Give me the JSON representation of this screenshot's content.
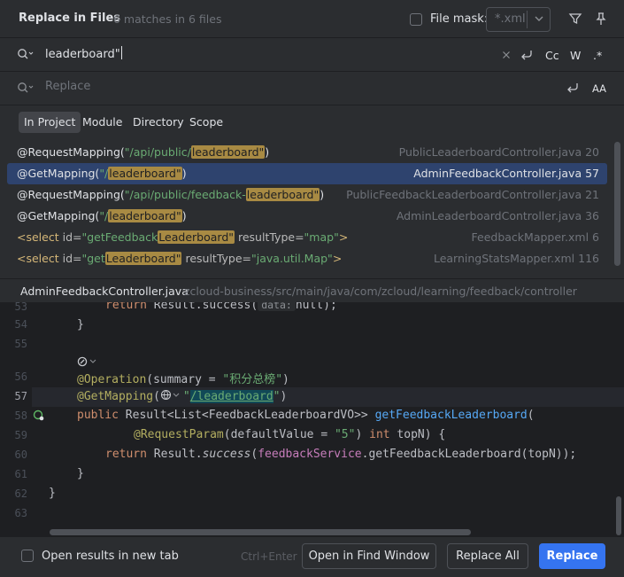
{
  "header": {
    "title": "Replace in Files",
    "match_count": "6 matches in 6 files",
    "file_mask_label": "File mask:",
    "file_mask_placeholder": "*.xml"
  },
  "search": {
    "value": "leaderboard\"",
    "toggles": [
      "Cc",
      "W",
      ".*"
    ]
  },
  "replace": {
    "placeholder": "Replace",
    "case_toggle": "AA"
  },
  "scope_tabs": [
    {
      "label": "In Project",
      "active": true
    },
    {
      "label": "Module"
    },
    {
      "label": "Directory"
    },
    {
      "label": "Scope"
    }
  ],
  "results": [
    {
      "pre": "@RequestMapping(",
      "str_pre": "\"/api/public/",
      "match": "leaderboard\"",
      "post": ")",
      "file": "PublicLeaderboardController.java",
      "line": "20"
    },
    {
      "pre": "@GetMapping(",
      "str_pre": "\"/",
      "match": "leaderboard\"",
      "post": ")",
      "file": "AdminFeedbackController.java",
      "line": "57",
      "selected": true
    },
    {
      "pre": "@RequestMapping(",
      "str_pre": "\"/api/public/feedback-",
      "match": "leaderboard\"",
      "post": ")",
      "file": "PublicFeedbackLeaderboardController.java",
      "line": "21"
    },
    {
      "pre": "@GetMapping(",
      "str_pre": "\"/",
      "match": "leaderboard\"",
      "post": ")",
      "file": "AdminLeaderboardController.java",
      "line": "36"
    },
    {
      "tag": "<select",
      "attr": " id=",
      "str_pre": "\"getFeedback",
      "match": "Leaderboard\"",
      "attr2": " resultType=",
      "str2": "\"map\"",
      "tail": ">",
      "file": "FeedbackMapper.xml",
      "line": "6"
    },
    {
      "tag": "<select",
      "attr": " id=",
      "str_pre": "\"get",
      "match": "Leaderboard\"",
      "attr2": " resultType=",
      "str2": "\"java.util.Map\"",
      "tail": ">",
      "file": "LearningStatsMapper.xml",
      "line": "116"
    }
  ],
  "preview": {
    "file_name": "AdminFeedbackController.java",
    "path": "zcloud-business/src/main/java/com/zcloud/learning/feedback/controller"
  },
  "editor": {
    "line_numbers": [
      "53",
      "54",
      "55",
      "",
      "56",
      "57",
      "58",
      "59",
      "60",
      "61",
      "62",
      "63"
    ],
    "current_line": "57",
    "lines": {
      "l53_kw": "return",
      "l53_a": " Result.success(",
      "l53_hint": "data:",
      "l53_b": "null);",
      "l54": "}",
      "l56_ann": "@Operation",
      "l56_a": "(summary = ",
      "l56_str": "\"积分总榜\"",
      "l56_b": ")",
      "l57_ann": "@GetMapping",
      "l57_a": "(",
      "l57_str_a": "\"",
      "l57_match": "/leaderboard",
      "l57_str_b": "\"",
      "l57_b": ")",
      "l58_kw": "public",
      "l58_a": " Result<List<FeedbackLeaderboardVO>> ",
      "l58_fn": "getFeedbackLeaderboard",
      "l58_b": "(",
      "l59_ann": "@RequestParam",
      "l59_a": "(defaultValue = ",
      "l59_str": "\"5\"",
      "l59_b": ") ",
      "l59_kw": "int",
      "l59_c": " topN) {",
      "l60_kw": "return",
      "l60_a": " Result.",
      "l60_it": "success",
      "l60_b": "(",
      "l60_fld": "feedbackService",
      "l60_c": ".getFeedbackLeaderboard(topN));",
      "l61": "}",
      "l62": "}"
    }
  },
  "footer": {
    "open_new_tab_label": "Open results in new tab",
    "shortcut": "Ctrl+Enter",
    "open_find_window": "Open in Find Window",
    "replace_all": "Replace All",
    "replace": "Replace"
  },
  "colors": {
    "accent": "#3574f0",
    "selection": "#2e436e",
    "match_highlight": "#a88a43"
  }
}
